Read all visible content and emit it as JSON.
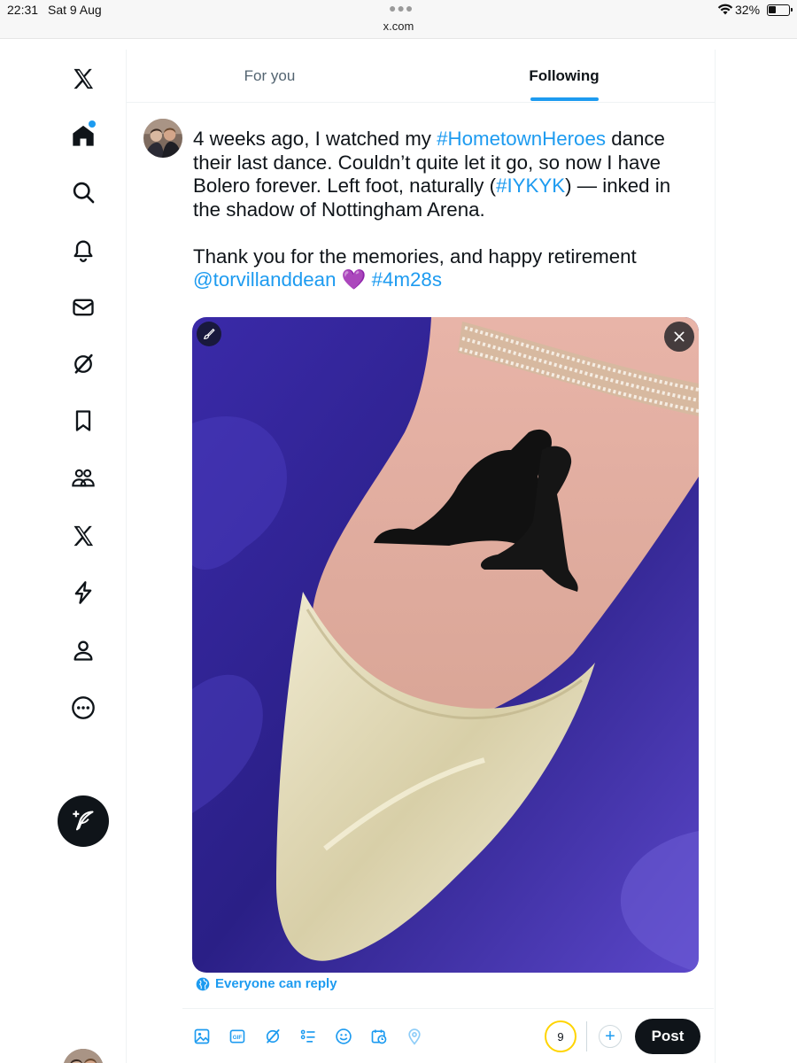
{
  "status_bar": {
    "time": "22:31",
    "date": "Sat 9 Aug",
    "url": "x.com",
    "battery": "32%"
  },
  "sidebar": {
    "items": [
      {
        "name": "x-logo-icon"
      },
      {
        "name": "home-icon",
        "has_notification_dot": true
      },
      {
        "name": "search-icon"
      },
      {
        "name": "bell-icon"
      },
      {
        "name": "mail-icon"
      },
      {
        "name": "grok-icon"
      },
      {
        "name": "bookmark-icon"
      },
      {
        "name": "communities-icon"
      },
      {
        "name": "premium-x-icon"
      },
      {
        "name": "lightning-icon"
      },
      {
        "name": "profile-icon"
      },
      {
        "name": "more-icon"
      }
    ],
    "compose_icon": "feather-plus-icon"
  },
  "tabs": {
    "for_you": "For you",
    "following": "Following",
    "active": "following"
  },
  "composer": {
    "line1_pre": "4 weeks ago, I watched my ",
    "hashtag1": "#HometownHeroes",
    "line1_mid": " dance their last dance. Couldn’t quite let it go, so now I have Bolero forever. Left foot, naturally (",
    "hashtag2": "#IYKYK",
    "line1_post": ") — inked in the shadow of Nottingham Arena.",
    "line2_pre": "Thank you for the memories, and happy retirement ",
    "mention": "@torvillanddean",
    "heart": "💜",
    "hashtag3": "#4m28s",
    "reply_setting": "Everyone can reply",
    "char_counter": "9",
    "post_button": "Post"
  },
  "colors": {
    "accent": "#1d9bf0",
    "text": "#0f1419",
    "muted": "#536471",
    "counter_ring": "#ffd400"
  }
}
